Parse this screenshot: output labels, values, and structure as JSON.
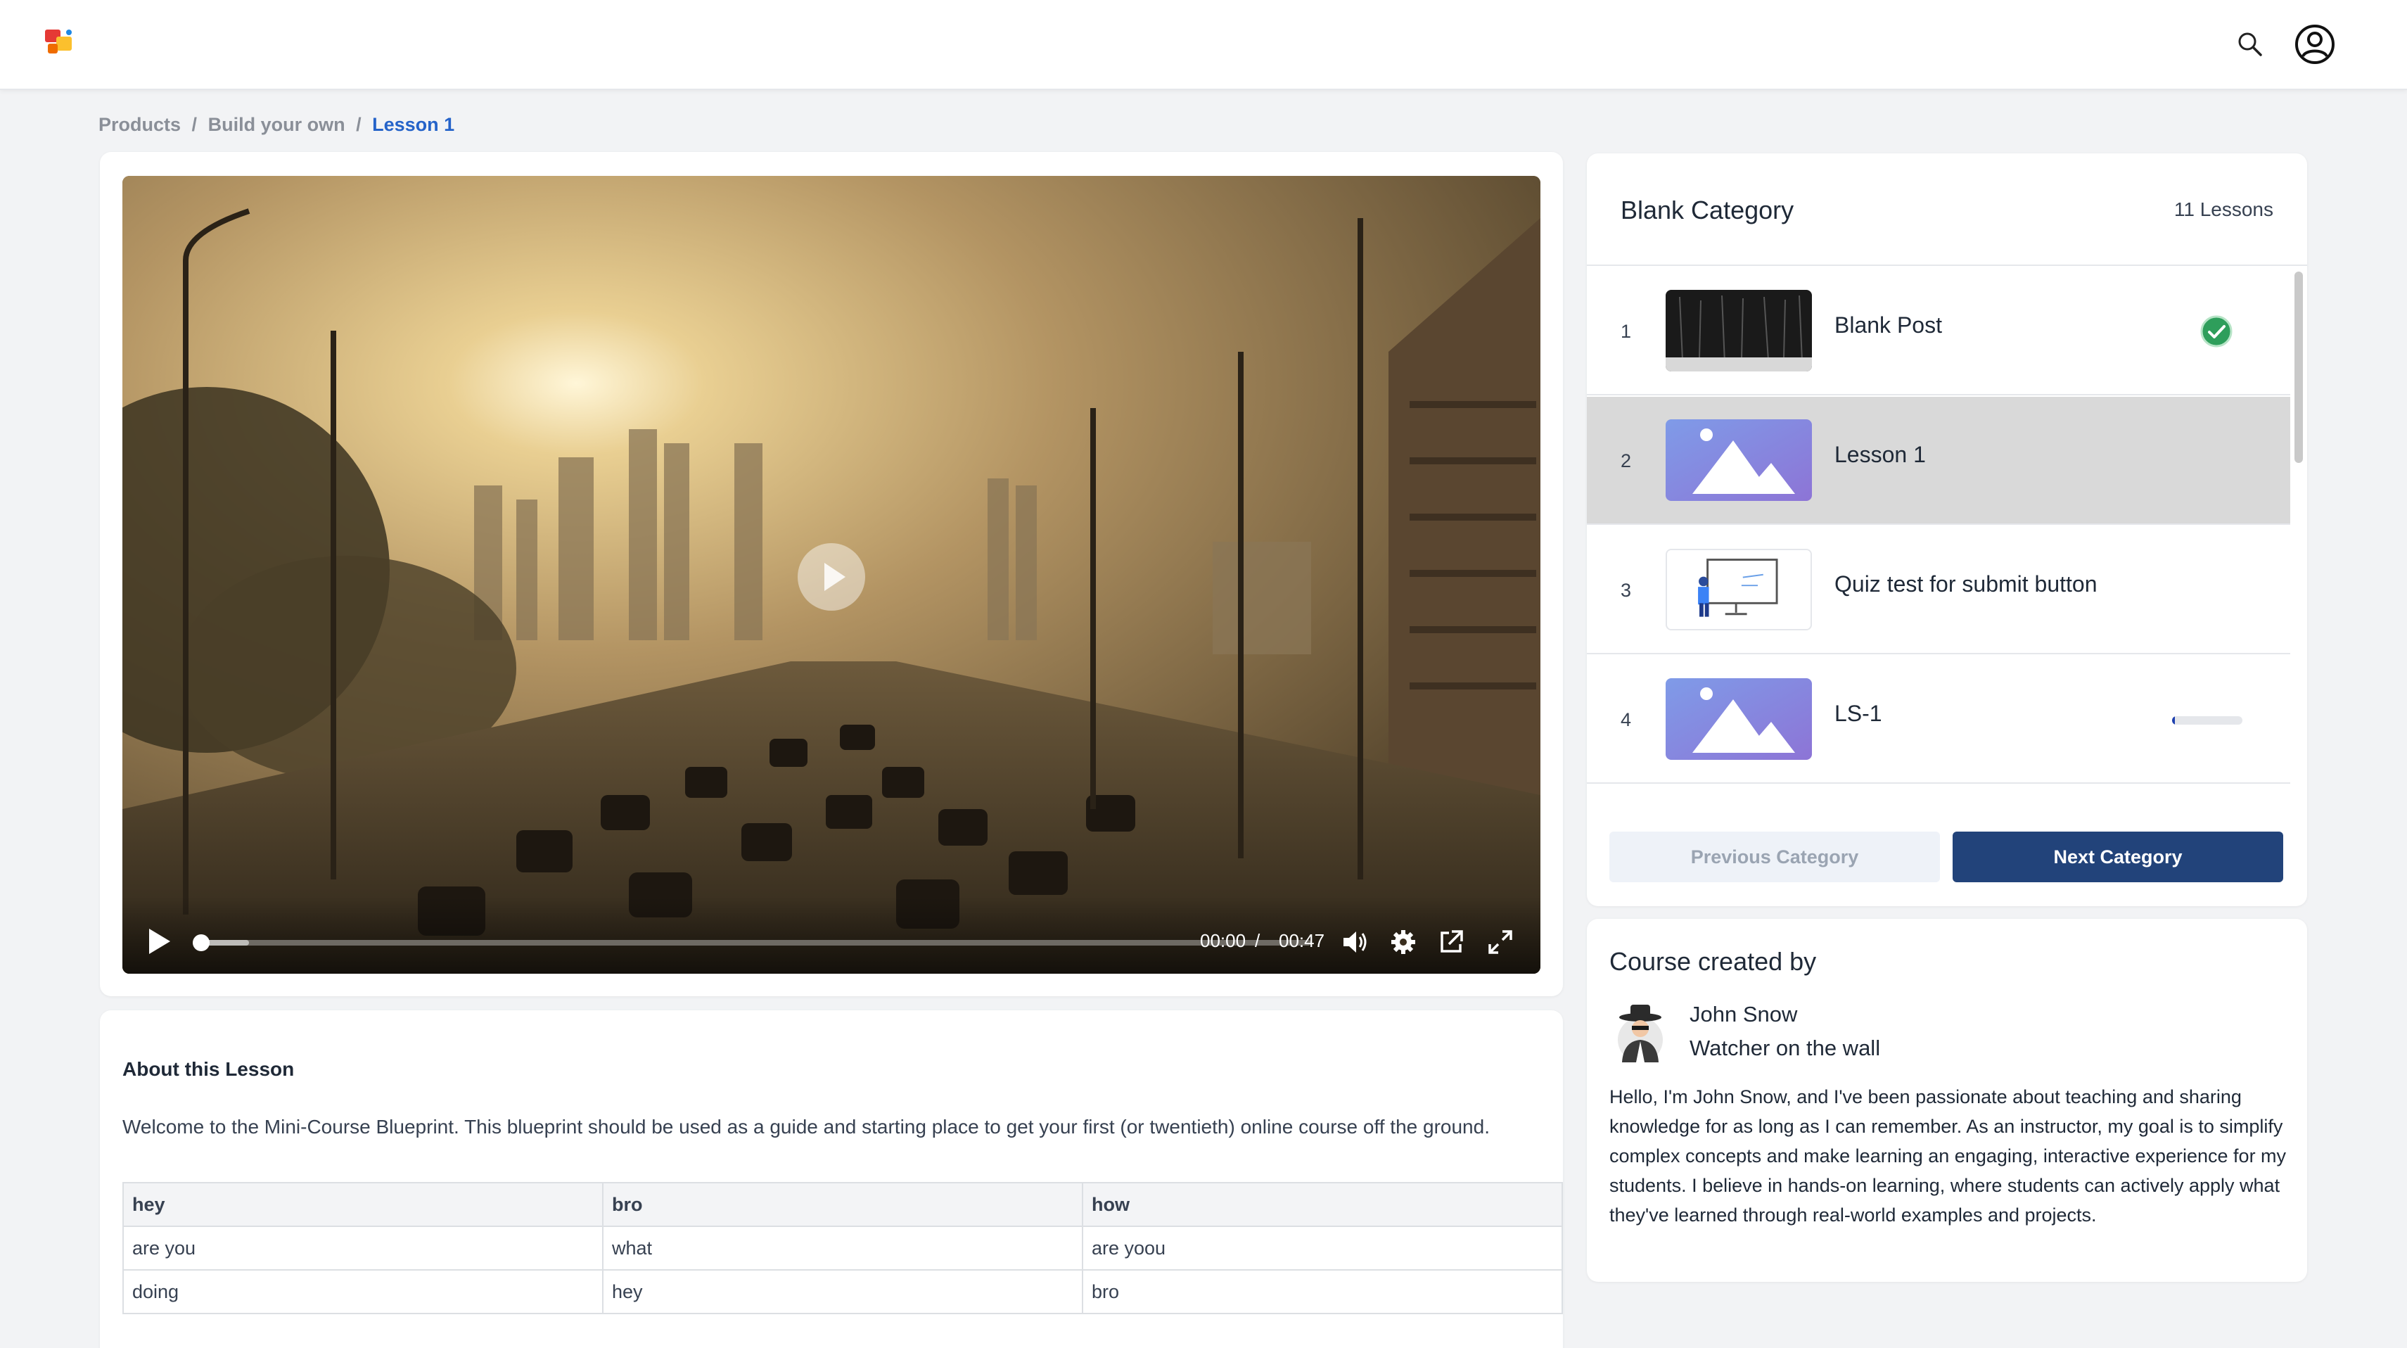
{
  "header": {
    "logo_icon": "app-logo-icon",
    "search_icon": "search-icon",
    "profile_icon": "user-profile-icon"
  },
  "breadcrumb": {
    "items": [
      "Products",
      "Build your own",
      "Lesson 1"
    ],
    "separator": "/"
  },
  "video": {
    "current_time": "00:00",
    "time_separator": "/",
    "duration": "00:47",
    "progress": 0,
    "buffered": 0.05,
    "icons": [
      "play-icon",
      "volume-icon",
      "settings-gear-icon",
      "open-external-icon",
      "fullscreen-icon"
    ]
  },
  "about": {
    "title": "About this Lesson",
    "text": "Welcome to the Mini-Course Blueprint. This blueprint should be used as a guide and starting place to get your first (or twentieth) online course off the ground.",
    "table": {
      "headers": [
        "hey",
        "bro",
        "how"
      ],
      "rows": [
        [
          "are you",
          "what",
          "are yoou"
        ],
        [
          "doing",
          "hey",
          "bro"
        ]
      ]
    }
  },
  "lessons": {
    "category_title": "Blank Category",
    "count_label": "11 Lessons",
    "items": [
      {
        "num": "1",
        "name": "Blank Post",
        "thumb": "dark-video-thumbnail",
        "status": "completed"
      },
      {
        "num": "2",
        "name": "Lesson 1",
        "thumb": "image-placeholder-thumbnail",
        "status": "active"
      },
      {
        "num": "3",
        "name": "Quiz test for submit button",
        "thumb": "quiz-illustration-thumbnail",
        "status": "none"
      },
      {
        "num": "4",
        "name": "LS-1",
        "thumb": "image-placeholder-thumbnail",
        "status": "in-progress",
        "progress": 0.04
      }
    ],
    "prev_label": "Previous Category",
    "next_label": "Next Category"
  },
  "creator": {
    "title": "Course created by",
    "name": "John Snow",
    "role": "Watcher on the wall",
    "bio": "Hello, I'm John Snow, and I've been passionate about teaching and sharing knowledge for as long as I can remember. As an instructor, my goal is to simplify complex concepts and make learning an engaging, interactive experience for my students. I believe in hands-on learning, where students can actively apply what they've learned through real-world examples and projects."
  },
  "colors": {
    "accent": "#2563c9",
    "next_button": "#22437a",
    "active_row": "#d9d9d9",
    "check": "#2e9e5b"
  }
}
